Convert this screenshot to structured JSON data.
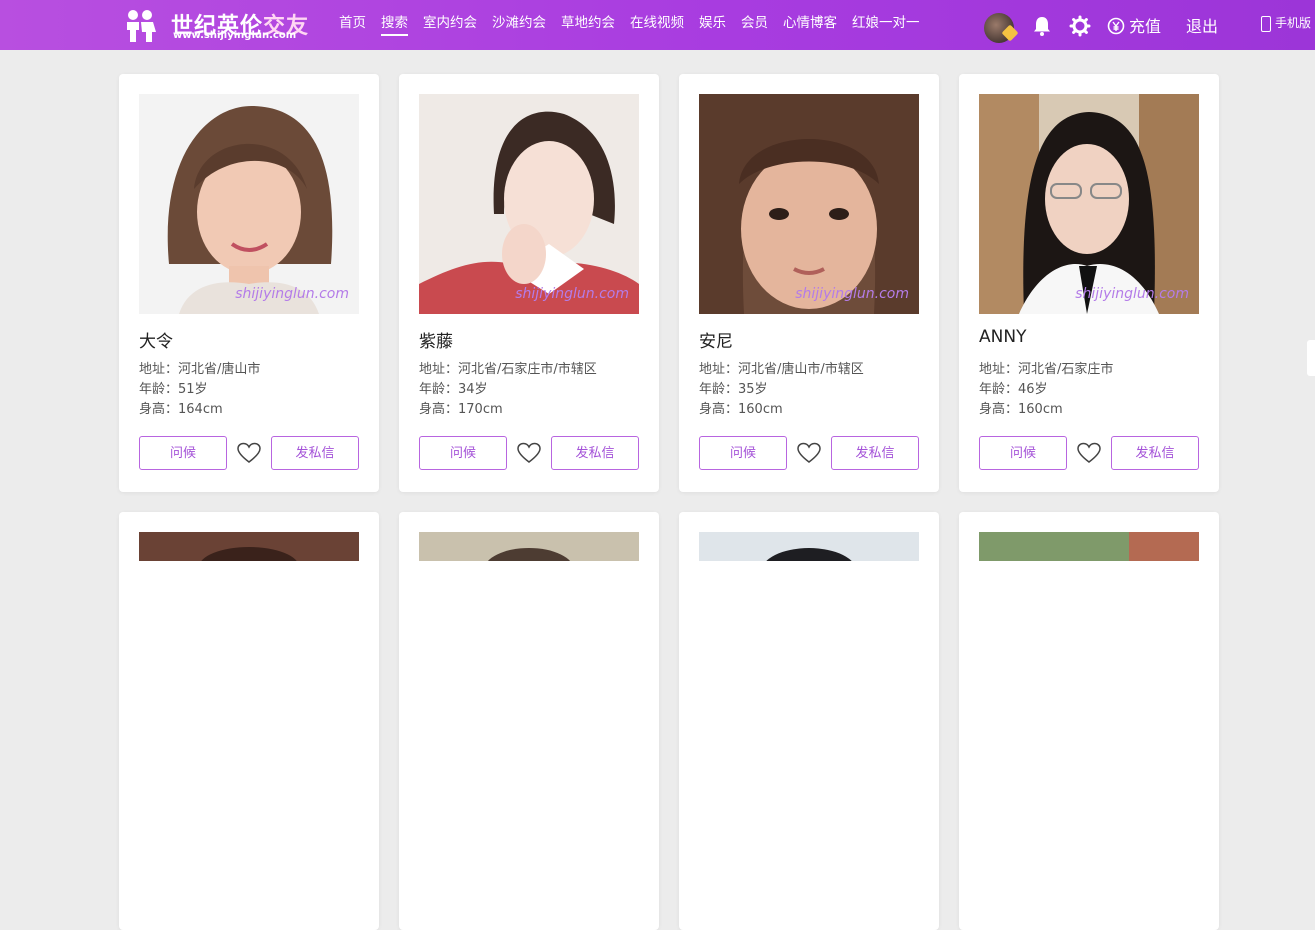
{
  "brand": {
    "title_main": "世纪英伦",
    "title_accent": "交友",
    "url": "www.shijiyinglun.com"
  },
  "nav": [
    {
      "label": "首页",
      "active": false
    },
    {
      "label": "搜索",
      "active": true
    },
    {
      "label": "室内约会",
      "active": false
    },
    {
      "label": "沙滩约会",
      "active": false
    },
    {
      "label": "草地约会",
      "active": false
    },
    {
      "label": "在线视频",
      "active": false
    },
    {
      "label": "娱乐",
      "active": false
    },
    {
      "label": "会员",
      "active": false
    },
    {
      "label": "心情博客",
      "active": false
    },
    {
      "label": "红娘一对一",
      "active": false
    }
  ],
  "header": {
    "recharge": "充值",
    "logout": "退出",
    "mobile": "手机版",
    "icons": [
      "avatar",
      "bell-icon",
      "gear-icon",
      "yuan-icon"
    ]
  },
  "labels": {
    "greet": "问候",
    "message": "发私信"
  },
  "watermark": "shijiyinglun.com",
  "profiles": [
    {
      "name": "大令",
      "address": "地址：河北省/唐山市",
      "age": "年龄：51岁",
      "height": "身高：164cm"
    },
    {
      "name": "紫藤",
      "address": "地址：河北省/石家庄市/市辖区",
      "age": "年龄：34岁",
      "height": "身高：170cm"
    },
    {
      "name": "安尼",
      "address": "地址：河北省/唐山市/市辖区",
      "age": "年龄：35岁",
      "height": "身高：160cm"
    },
    {
      "name": "ANNY",
      "address": "地址：河北省/石家庄市",
      "age": "年龄：46岁",
      "height": "身高：160cm"
    }
  ],
  "colors": {
    "header_start": "#b84fe0",
    "header_end": "#9c35d8",
    "accent": "#a452d8",
    "background": "#ececec"
  }
}
